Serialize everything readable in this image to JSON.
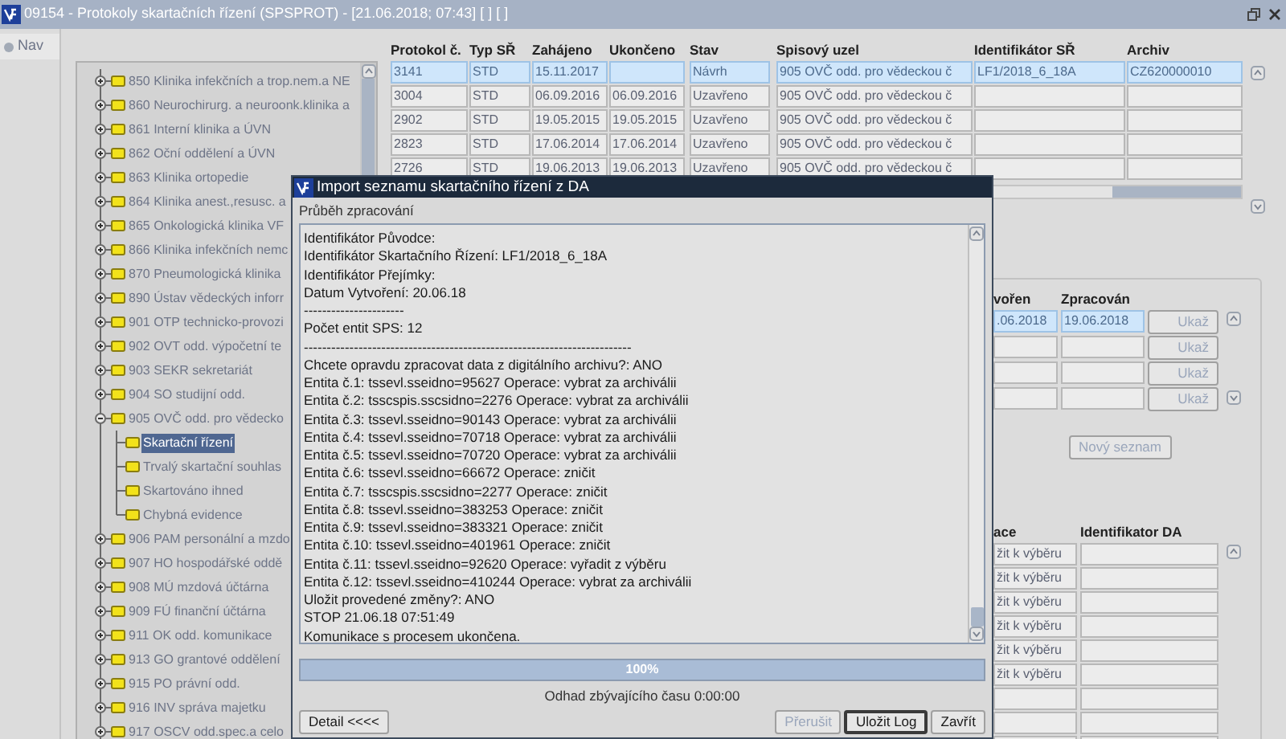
{
  "window": {
    "title": "09154 - Protokoly skartačních řízení (SPSPROT) - [21.06.2018; 07:43] [ ] [ ]"
  },
  "nav": {
    "label": "Nav"
  },
  "tree": {
    "items": [
      {
        "label": "850 Klinika infekčních a trop.nem.a NE",
        "expanded": false,
        "selected": false
      },
      {
        "label": "860 Neurochirurg. a neuroonk.klinika a",
        "expanded": false,
        "selected": false
      },
      {
        "label": "861 Interní klinika a ÚVN",
        "expanded": false,
        "selected": false
      },
      {
        "label": "862 Oční oddělení a ÚVN",
        "expanded": false,
        "selected": false
      },
      {
        "label": "863 Klinika ortopedie",
        "expanded": false,
        "selected": false
      },
      {
        "label": "864 Klinika anest.,resusc. a",
        "expanded": false,
        "selected": false
      },
      {
        "label": "865 Onkologická klinika VF",
        "expanded": false,
        "selected": false
      },
      {
        "label": "866 Klinika infekčních nemc",
        "expanded": false,
        "selected": false
      },
      {
        "label": "870 Pneumologická klinika",
        "expanded": false,
        "selected": false
      },
      {
        "label": "890 Ústav vědeckých inforr",
        "expanded": false,
        "selected": false
      },
      {
        "label": "901 OTP technicko-provozi",
        "expanded": false,
        "selected": false
      },
      {
        "label": "902 OVT odd. výpočetní te",
        "expanded": false,
        "selected": false
      },
      {
        "label": "903 SEKR sekretariát",
        "expanded": false,
        "selected": false
      },
      {
        "label": "904 SO studijní odd.",
        "expanded": false,
        "selected": false
      },
      {
        "label": "905 OVČ odd. pro vědecko",
        "expanded": true,
        "selected": false,
        "children": [
          {
            "label": "Skartační řízení",
            "selected": true
          },
          {
            "label": "Trvalý skartační souhlas",
            "selected": false
          },
          {
            "label": "Skartováno ihned",
            "selected": false
          },
          {
            "label": "Chybná evidence",
            "selected": false
          }
        ]
      },
      {
        "label": "906 PAM personální a mzdo",
        "expanded": false,
        "selected": false
      },
      {
        "label": "907 HO hospodářské oddě",
        "expanded": false,
        "selected": false
      },
      {
        "label": "908 MÚ mzdová účtárna",
        "expanded": false,
        "selected": false
      },
      {
        "label": "909 FÚ finanční účtárna",
        "expanded": false,
        "selected": false
      },
      {
        "label": "911 OK odd. komunikace",
        "expanded": false,
        "selected": false
      },
      {
        "label": "913 GO grantové oddělení",
        "expanded": false,
        "selected": false
      },
      {
        "label": "915 PO právní odd.",
        "expanded": false,
        "selected": false
      },
      {
        "label": "916 INV správa majetku",
        "expanded": false,
        "selected": false
      },
      {
        "label": "917 OSCV odd.spec.a celo",
        "expanded": false,
        "selected": false
      }
    ]
  },
  "protocols": {
    "columns": [
      "Protokol č.",
      "Typ SŘ",
      "Zahájeno",
      "Ukončeno",
      "Stav",
      "Spisový uzel",
      "Identifikátor SŘ",
      "Archiv"
    ],
    "rows": [
      {
        "selected": true,
        "cells": [
          "3141",
          "STD",
          "15.11.2017",
          null,
          "Návrh",
          "905 OVČ odd. pro vědeckou č",
          "LF1/2018_6_18A",
          "CZ620000010"
        ]
      },
      {
        "selected": false,
        "cells": [
          "3004",
          "STD",
          "06.09.2016",
          "06.09.2016",
          "Uzavřeno",
          "905 OVČ odd. pro vědeckou č",
          null,
          null
        ]
      },
      {
        "selected": false,
        "cells": [
          "2902",
          "STD",
          "19.05.2015",
          "19.05.2015",
          "Uzavřeno",
          "905 OVČ odd. pro vědeckou č",
          null,
          null
        ]
      },
      {
        "selected": false,
        "cells": [
          "2823",
          "STD",
          "17.06.2014",
          "17.06.2014",
          "Uzavřeno",
          "905 OVČ odd. pro vědeckou č",
          null,
          null
        ]
      },
      {
        "selected": false,
        "cells": [
          "2726",
          "STD",
          "19.06.2013",
          "19.06.2013",
          "Uzavřeno",
          "905 OVČ odd. pro vědeckou č",
          null,
          null
        ]
      }
    ]
  },
  "lists": {
    "columns": [
      "vořen",
      "Zpracován"
    ],
    "rows": [
      {
        "selected": true,
        "cells": [
          ".06.2018",
          "19.06.2018"
        ],
        "button": {
          "label": "Ukaž",
          "disabled": true
        }
      },
      {
        "selected": false,
        "cells": [
          null,
          null
        ],
        "button": {
          "label": "Ukaž",
          "disabled": true
        }
      },
      {
        "selected": false,
        "cells": [
          null,
          null
        ],
        "button": {
          "label": "Ukaž",
          "disabled": true
        }
      },
      {
        "selected": false,
        "cells": [
          null,
          null
        ],
        "button": {
          "label": "Ukaž",
          "disabled": true
        }
      }
    ],
    "new_button": {
      "label": "Nový seznam",
      "disabled": true
    }
  },
  "entities": {
    "columns": [
      "ace",
      "Identifikator DA"
    ],
    "rows": [
      {
        "cells": [
          "žit k výběru",
          null
        ]
      },
      {
        "cells": [
          "žit k výběru",
          null
        ]
      },
      {
        "cells": [
          "žit k výběru",
          null
        ]
      },
      {
        "cells": [
          "žit k výběru",
          null
        ]
      },
      {
        "cells": [
          "žit k výběru",
          null
        ]
      },
      {
        "cells": [
          "žit k výběru",
          null
        ]
      },
      {
        "cells": [
          null,
          null
        ]
      },
      {
        "cells": [
          null,
          null
        ]
      },
      {
        "cells": [
          null,
          null
        ]
      }
    ]
  },
  "dialog": {
    "title": "Import seznamu skartačního řízení z DA",
    "section": "Průběh zpracování",
    "log": [
      "Identifikátor Původce:",
      "Identifikátor Skartačního Řízení: LF1/2018_6_18A",
      "Identifikátor Přejímky:",
      "Datum Vytvoření: 20.06.18",
      "----------------------",
      "Počet entit SPS: 12",
      "------------------------------------------------------------------------",
      "Chcete opravdu zpracovat data z digitálního archivu?: ANO",
      "Entita č.1: tssevl.sseidno=95627 Operace: vybrat za archiválii",
      "Entita č.2: tsscspis.sscsidno=2276 Operace: vybrat za archiválii",
      "Entita č.3: tssevl.sseidno=90143 Operace: vybrat za archiválii",
      "Entita č.4: tssevl.sseidno=70718 Operace: vybrat za archiválii",
      "Entita č.5: tssevl.sseidno=70720 Operace: vybrat za archiválii",
      "Entita č.6: tssevl.sseidno=66672 Operace: zničit",
      "Entita č.7: tsscspis.sscsidno=2277 Operace: zničit",
      "Entita č.8: tssevl.sseidno=383253 Operace: zničit",
      "Entita č.9: tssevl.sseidno=383321 Operace: zničit",
      "Entita č.10: tssevl.sseidno=401961 Operace: zničit",
      "Entita č.11: tssevl.sseidno=92620 Operace: vyřadit z výběru",
      "Entita č.12: tssevl.sseidno=410244 Operace: vybrat za archiválii",
      "Uložit provedené změny?: ANO",
      "STOP 21.06.18 07:51:49",
      "Komunikace s procesem ukončena."
    ],
    "progress": {
      "level": 1,
      "label": "100%"
    },
    "eta": "Odhad zbývajícího času 0:00:00",
    "detail_button": {
      "label": "Detail <<<<",
      "disabled": false,
      "focused": false
    },
    "buttons": [
      {
        "label": "Přerušit",
        "disabled": true,
        "focused": false
      },
      {
        "label": "Uložit Log",
        "disabled": false,
        "focused": true
      },
      {
        "label": "Zavřít",
        "disabled": false,
        "focused": false
      }
    ]
  }
}
